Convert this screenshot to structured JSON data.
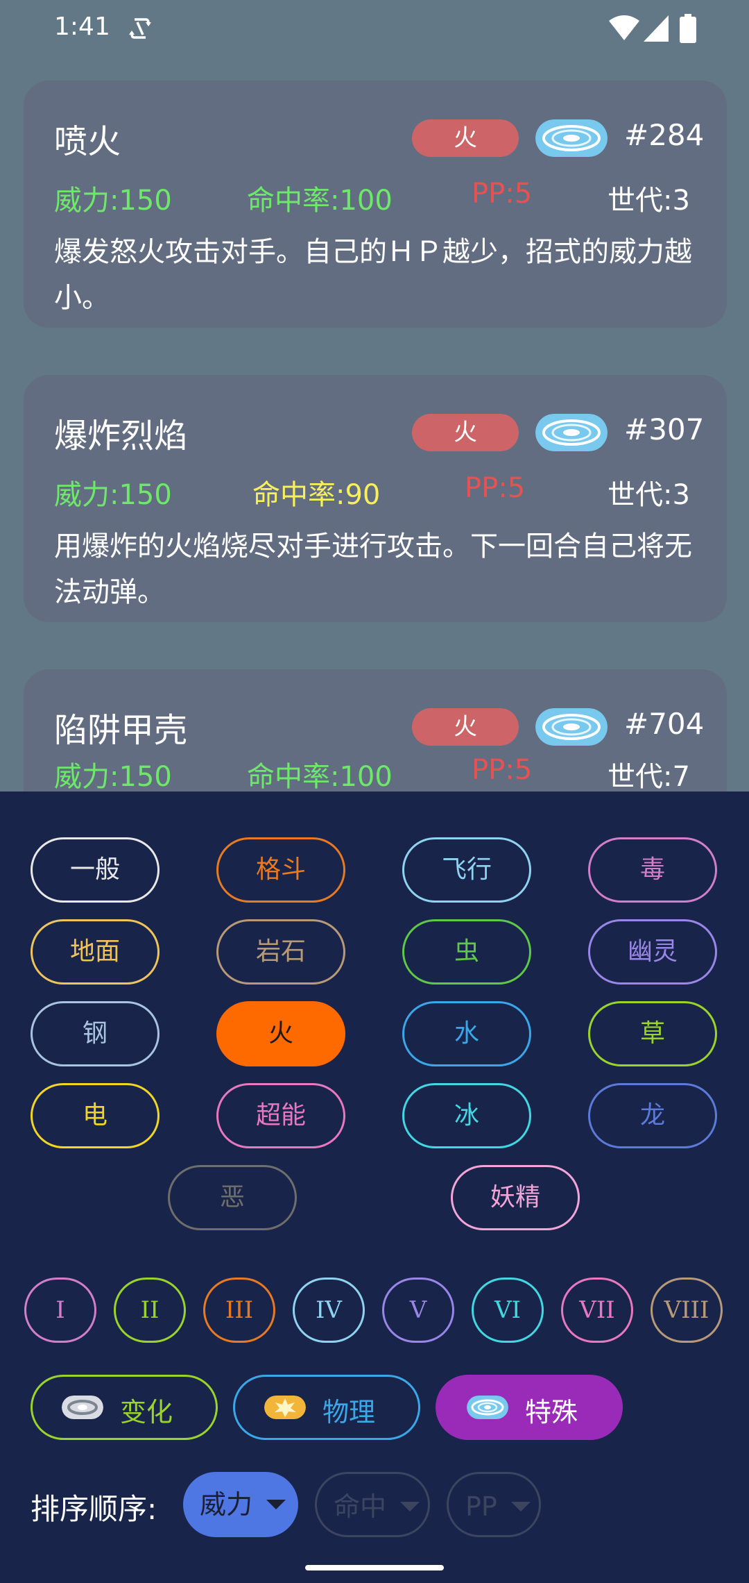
{
  "status_bar": {
    "time": "1:41",
    "icons": [
      "sync-icon",
      "wifi-icon",
      "signal-icon",
      "battery-icon"
    ]
  },
  "moves": [
    {
      "name": "喷火",
      "type": "火",
      "category_icon": "special-category-icon",
      "number": "#284",
      "power": "威力:150",
      "accuracy": "命中率:100",
      "pp": "PP:5",
      "generation": "世代:3",
      "description": "爆发怒火攻击对手。自己的ＨＰ越少，招式的威力越小。"
    },
    {
      "name": "爆炸烈焰",
      "type": "火",
      "category_icon": "special-category-icon",
      "number": "#307",
      "power": "威力:150",
      "accuracy": "命中率:90",
      "pp": "PP:5",
      "generation": "世代:3",
      "description": "用爆炸的火焰烧尽对手进行攻击。下一回合自己将无法动弹。"
    },
    {
      "name": "陷阱甲壳",
      "type": "火",
      "category_icon": "special-category-icon",
      "number": "#704",
      "power": "威力:150",
      "accuracy": "命中率:100",
      "pp": "PP:5",
      "generation": "世代:7",
      "description": ""
    }
  ],
  "type_filters": [
    {
      "label": "一般",
      "color": "#e8e8e8",
      "selected": false
    },
    {
      "label": "格斗",
      "color": "#e87a22",
      "selected": false
    },
    {
      "label": "飞行",
      "color": "#8fd3f0",
      "selected": false
    },
    {
      "label": "毒",
      "color": "#d27fc9",
      "selected": false
    },
    {
      "label": "地面",
      "color": "#f0c45a",
      "selected": false
    },
    {
      "label": "岩石",
      "color": "#b89a78",
      "selected": false
    },
    {
      "label": "虫",
      "color": "#5ec848",
      "selected": false
    },
    {
      "label": "幽灵",
      "color": "#9a86e8",
      "selected": false
    },
    {
      "label": "钢",
      "color": "#a8c4e0",
      "selected": false
    },
    {
      "label": "火",
      "color": "#ff6a00",
      "selected": true
    },
    {
      "label": "水",
      "color": "#3aa8e8",
      "selected": false
    },
    {
      "label": "草",
      "color": "#9ad42a",
      "selected": false
    },
    {
      "label": "电",
      "color": "#f2d624",
      "selected": false
    },
    {
      "label": "超能",
      "color": "#e878c0",
      "selected": false
    },
    {
      "label": "冰",
      "color": "#42d8e2",
      "selected": false
    },
    {
      "label": "龙",
      "color": "#5c7ad8",
      "selected": false
    },
    {
      "label": "恶",
      "color": "#6e6e6e",
      "selected": false
    },
    {
      "label": "妖精",
      "color": "#f2a6d8",
      "selected": false
    }
  ],
  "generation_filters": [
    {
      "label": "I",
      "color": "#d27fc9"
    },
    {
      "label": "II",
      "color": "#9ad42a"
    },
    {
      "label": "III",
      "color": "#e87a22"
    },
    {
      "label": "IV",
      "color": "#8fd3f0"
    },
    {
      "label": "V",
      "color": "#9a86e8"
    },
    {
      "label": "VI",
      "color": "#42d8e2"
    },
    {
      "label": "VII",
      "color": "#e878c0"
    },
    {
      "label": "VIII",
      "color": "#b89a78"
    }
  ],
  "category_filters": [
    {
      "label": "变化",
      "color": "#9ad42a",
      "icon": "status-category-icon",
      "selected": false
    },
    {
      "label": "物理",
      "color": "#3aa8e8",
      "icon": "physical-category-icon",
      "selected": false
    },
    {
      "label": "特殊",
      "color": "#9a2bb8",
      "icon": "special-category-icon",
      "selected": true
    }
  ],
  "sort": {
    "label": "排序顺序:",
    "options": [
      {
        "label": "威力",
        "active": true
      },
      {
        "label": "命中",
        "active": false
      },
      {
        "label": "PP",
        "active": false
      }
    ]
  },
  "colors": {
    "background": "#637887",
    "card": "#636d82",
    "panel": "#18244a",
    "fire_pill": "#cc6468",
    "sort_active": "#4f77e4"
  }
}
